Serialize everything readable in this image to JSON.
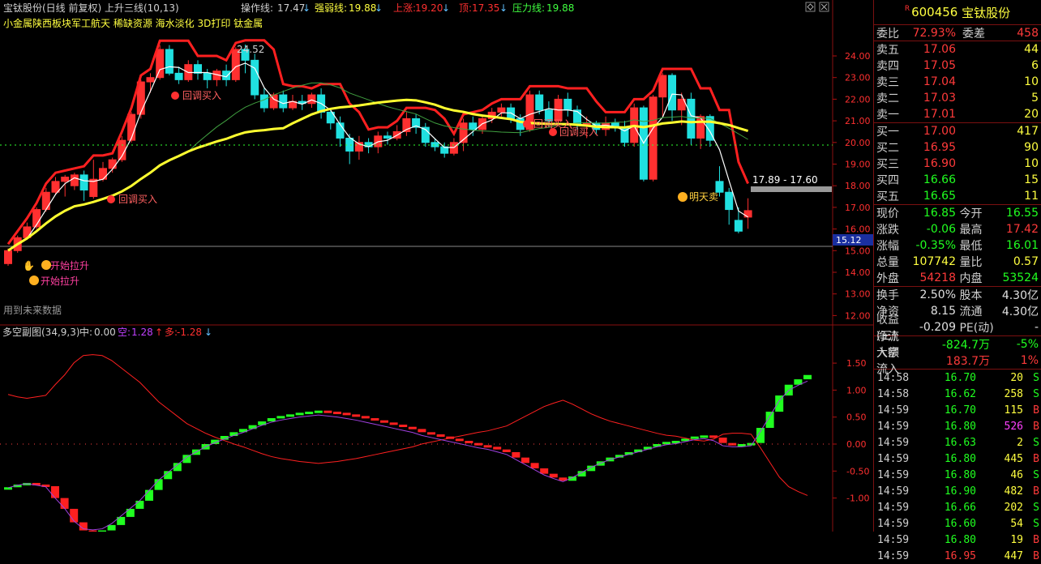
{
  "header": {
    "title": "宝钛股份(日线 前复权) 上升三线(10,13)",
    "op_label": "操作线:",
    "op_val": "17.47",
    "strong_label": "强弱线:",
    "strong_val": "19.88",
    "up_label": "上涨:",
    "up_val": "19.20",
    "top_label": "顶:",
    "top_val": "17.35",
    "press_label": "压力线:",
    "press_val": "19.88"
  },
  "concepts": "小金属陕西板块军工航天 稀缺资源 海水淡化 3D打印 钛金属",
  "annotations": {
    "peak": "24.52",
    "buy1": "回调买入",
    "buy2": "回调买入",
    "buy3": "回调买入",
    "buy4": "回调买入",
    "start1": "开始拉升",
    "start2": "开始拉升",
    "sell": "明天卖",
    "range": "17.89 - 17.60",
    "price_tag": "15.12",
    "future": "用到未来数据"
  },
  "y_axis_main": [
    "24.00",
    "23.00",
    "22.00",
    "21.00",
    "20.00",
    "19.00",
    "18.00",
    "17.00",
    "16.00",
    "15.00",
    "14.00",
    "13.00",
    "12.00"
  ],
  "sub": {
    "title": "多空副图(34,9,3)",
    "mid_label": "中:",
    "mid_val": "0.00",
    "empty_label": "空:",
    "empty_val": "1.28",
    "more_label": "多:",
    "more_val": "-1.28",
    "y_axis": [
      "1.50",
      "1.00",
      "0.50",
      "0.00",
      "-0.50",
      "-1.00"
    ]
  },
  "panel": {
    "code": "600456",
    "name": "宝钛股份",
    "weibi_label": "委比",
    "weibi": "72.93%",
    "weicha_label": "委差",
    "weicha": "458",
    "asks": [
      {
        "label": "卖五",
        "price": "17.06",
        "vol": "44"
      },
      {
        "label": "卖四",
        "price": "17.05",
        "vol": "6"
      },
      {
        "label": "卖三",
        "price": "17.04",
        "vol": "10"
      },
      {
        "label": "卖二",
        "price": "17.03",
        "vol": "5"
      },
      {
        "label": "卖一",
        "price": "17.01",
        "vol": "20"
      }
    ],
    "bids": [
      {
        "label": "买一",
        "price": "17.00",
        "vol": "417"
      },
      {
        "label": "买二",
        "price": "16.95",
        "vol": "90"
      },
      {
        "label": "买三",
        "price": "16.90",
        "vol": "10"
      },
      {
        "label": "买四",
        "price": "16.66",
        "vol": "15"
      },
      {
        "label": "买五",
        "price": "16.65",
        "vol": "11"
      }
    ],
    "stats": [
      {
        "l1": "现价",
        "v1": "16.85",
        "c1": "green",
        "l2": "今开",
        "v2": "16.55",
        "c2": "green"
      },
      {
        "l1": "涨跌",
        "v1": "-0.06",
        "c1": "green",
        "l2": "最高",
        "v2": "17.42",
        "c2": "red"
      },
      {
        "l1": "涨幅",
        "v1": "-0.35%",
        "c1": "green",
        "l2": "最低",
        "v2": "16.01",
        "c2": "green"
      },
      {
        "l1": "总量",
        "v1": "107742",
        "c1": "yellow",
        "l2": "量比",
        "v2": "0.57",
        "c2": "yellow"
      },
      {
        "l1": "外盘",
        "v1": "54218",
        "c1": "red",
        "l2": "内盘",
        "v2": "53524",
        "c2": "green"
      }
    ],
    "stats2": [
      {
        "l1": "换手",
        "v1": "2.50%",
        "c1": "white",
        "l2": "股本",
        "v2": "4.30亿",
        "c2": "white"
      },
      {
        "l1": "净资",
        "v1": "8.15",
        "c1": "white",
        "l2": "流通",
        "v2": "4.30亿",
        "c2": "white"
      },
      {
        "l1": "收益(三)",
        "v1": "-0.209",
        "c1": "white",
        "l2": "PE(动)",
        "v2": "-",
        "c2": "white"
      }
    ],
    "flow": [
      {
        "label": "净流入额",
        "val": "-824.7万",
        "pct": "-5%",
        "c": "green"
      },
      {
        "label": "大宗流入",
        "val": "183.7万",
        "pct": "1%",
        "c": "red"
      }
    ],
    "ticks": [
      {
        "t": "14:58",
        "p": "16.70",
        "v": "20",
        "bs": "S",
        "pc": "green",
        "vc": "yellow"
      },
      {
        "t": "14:58",
        "p": "16.62",
        "v": "258",
        "bs": "S",
        "pc": "green",
        "vc": "yellow"
      },
      {
        "t": "14:59",
        "p": "16.70",
        "v": "115",
        "bs": "B",
        "pc": "green",
        "vc": "yellow"
      },
      {
        "t": "14:59",
        "p": "16.80",
        "v": "526",
        "bs": "B",
        "pc": "green",
        "vc": "magenta"
      },
      {
        "t": "14:59",
        "p": "16.63",
        "v": "2",
        "bs": "S",
        "pc": "green",
        "vc": "yellow"
      },
      {
        "t": "14:59",
        "p": "16.80",
        "v": "445",
        "bs": "B",
        "pc": "green",
        "vc": "yellow"
      },
      {
        "t": "14:59",
        "p": "16.80",
        "v": "46",
        "bs": "S",
        "pc": "green",
        "vc": "yellow"
      },
      {
        "t": "14:59",
        "p": "16.90",
        "v": "482",
        "bs": "B",
        "pc": "green",
        "vc": "yellow"
      },
      {
        "t": "14:59",
        "p": "16.66",
        "v": "202",
        "bs": "S",
        "pc": "green",
        "vc": "yellow"
      },
      {
        "t": "14:59",
        "p": "16.60",
        "v": "54",
        "bs": "S",
        "pc": "green",
        "vc": "yellow"
      },
      {
        "t": "14:59",
        "p": "16.80",
        "v": "19",
        "bs": "B",
        "pc": "green",
        "vc": "yellow"
      },
      {
        "t": "14:59",
        "p": "16.95",
        "v": "447",
        "bs": "B",
        "pc": "red",
        "vc": "yellow"
      }
    ]
  },
  "colors": {
    "up": "#ff3030",
    "down": "#20e0e0",
    "ma_white": "#ffffff",
    "ma_yellow": "#ffff30",
    "ma_red": "#ff2020",
    "ma_blue": "#2040ff",
    "ma_green": "#40a040"
  },
  "chart_data": {
    "type": "candlestick",
    "y_axis_range": [
      12,
      24.6
    ],
    "candles": [
      [
        14.4,
        15.0,
        15.1,
        14.3
      ],
      [
        15.0,
        15.6,
        15.7,
        14.9
      ],
      [
        15.6,
        16.1,
        16.3,
        15.5
      ],
      [
        16.1,
        16.9,
        17.0,
        16.0
      ],
      [
        16.9,
        17.7,
        17.9,
        16.8
      ],
      [
        17.7,
        18.2,
        18.4,
        17.6
      ],
      [
        18.2,
        18.4,
        18.5,
        17.5
      ],
      [
        18.0,
        18.5,
        18.6,
        17.8
      ],
      [
        18.5,
        17.8,
        18.7,
        17.3
      ],
      [
        17.5,
        18.3,
        19.2,
        17.4
      ],
      [
        18.3,
        18.8,
        19.1,
        18.2
      ],
      [
        18.8,
        19.2,
        19.3,
        18.6
      ],
      [
        19.2,
        20.1,
        20.3,
        19.1
      ],
      [
        20.1,
        21.3,
        21.4,
        20.0
      ],
      [
        21.3,
        22.8,
        22.9,
        21.1
      ],
      [
        22.8,
        23.0,
        23.2,
        22.3
      ],
      [
        23.0,
        24.3,
        24.5,
        22.9
      ],
      [
        24.3,
        23.2,
        24.5,
        23.1
      ],
      [
        23.2,
        22.9,
        23.5,
        22.7
      ],
      [
        22.9,
        23.6,
        23.8,
        22.8
      ],
      [
        23.6,
        23.2,
        23.8,
        22.9
      ],
      [
        23.2,
        22.9,
        23.4,
        22.5
      ],
      [
        22.9,
        23.3,
        23.4,
        22.6
      ],
      [
        23.3,
        22.9,
        23.6,
        22.6
      ],
      [
        22.9,
        24.3,
        24.4,
        22.8
      ],
      [
        24.3,
        23.8,
        24.52,
        23.2
      ],
      [
        23.8,
        22.2,
        24.1,
        22.0
      ],
      [
        22.2,
        21.6,
        22.5,
        21.4
      ],
      [
        21.6,
        22.2,
        22.3,
        21.5
      ],
      [
        22.2,
        21.6,
        22.4,
        21.4
      ],
      [
        21.6,
        21.9,
        22.2,
        21.5
      ],
      [
        21.9,
        21.8,
        22.2,
        21.5
      ],
      [
        21.8,
        22.2,
        22.3,
        21.6
      ],
      [
        22.2,
        21.4,
        22.5,
        21.1
      ],
      [
        21.4,
        20.9,
        21.6,
        20.6
      ],
      [
        20.9,
        20.2,
        21.2,
        19.8
      ],
      [
        20.2,
        19.6,
        20.4,
        19.0
      ],
      [
        19.6,
        20.0,
        20.3,
        19.2
      ],
      [
        20.0,
        19.8,
        20.2,
        19.5
      ],
      [
        19.8,
        20.3,
        20.5,
        19.5
      ],
      [
        20.3,
        20.2,
        20.5,
        19.9
      ],
      [
        20.2,
        20.5,
        20.8,
        20.1
      ],
      [
        20.5,
        21.1,
        21.4,
        20.3
      ],
      [
        21.1,
        20.7,
        21.3,
        20.4
      ],
      [
        20.7,
        20.0,
        20.9,
        19.8
      ],
      [
        20.0,
        19.8,
        20.2,
        19.6
      ],
      [
        19.8,
        19.5,
        20.0,
        19.3
      ],
      [
        19.5,
        20.0,
        20.2,
        19.4
      ],
      [
        20.0,
        20.9,
        21.1,
        19.6
      ],
      [
        20.9,
        20.6,
        21.2,
        20.3
      ],
      [
        20.6,
        21.1,
        21.3,
        20.4
      ],
      [
        21.1,
        21.4,
        21.6,
        20.9
      ],
      [
        21.4,
        21.6,
        21.8,
        21.2
      ],
      [
        21.6,
        21.1,
        21.8,
        20.9
      ],
      [
        21.1,
        20.6,
        21.3,
        20.3
      ],
      [
        20.6,
        22.2,
        22.4,
        20.5
      ],
      [
        22.2,
        21.5,
        22.4,
        21.3
      ],
      [
        21.5,
        21.0,
        21.9,
        20.7
      ],
      [
        21.0,
        22.0,
        22.2,
        20.9
      ],
      [
        22.0,
        21.5,
        22.3,
        21.2
      ],
      [
        21.5,
        20.8,
        21.7,
        20.6
      ],
      [
        20.8,
        20.9,
        21.2,
        20.2
      ],
      [
        20.9,
        20.6,
        21.0,
        20.4
      ],
      [
        20.6,
        20.9,
        21.2,
        20.3
      ],
      [
        20.9,
        20.7,
        21.1,
        20.5
      ],
      [
        20.7,
        20.0,
        21.0,
        19.8
      ],
      [
        20.0,
        21.6,
        21.8,
        19.8
      ],
      [
        21.6,
        18.3,
        21.7,
        18.2
      ],
      [
        18.3,
        22.1,
        22.2,
        18.2
      ],
      [
        22.1,
        23.1,
        23.2,
        21.2
      ],
      [
        23.1,
        21.5,
        23.2,
        21.0
      ],
      [
        21.5,
        22.0,
        22.3,
        20.8
      ],
      [
        22.0,
        20.2,
        22.3,
        19.9
      ],
      [
        20.2,
        21.2,
        21.3,
        19.7
      ],
      [
        21.2,
        20.1,
        21.3,
        19.8
      ],
      [
        18.2,
        17.7,
        18.9,
        17.5
      ],
      [
        17.7,
        16.9,
        17.9,
        16.2
      ],
      [
        16.4,
        15.9,
        17.0,
        15.8
      ],
      [
        16.55,
        16.85,
        17.42,
        16.01
      ]
    ],
    "sub_series": {
      "type": "bar",
      "values": [
        -0.8,
        -0.75,
        -0.72,
        -0.75,
        -0.78,
        -1.0,
        -1.2,
        -1.45,
        -1.6,
        -1.62,
        -1.6,
        -1.5,
        -1.35,
        -1.2,
        -1.05,
        -0.85,
        -0.65,
        -0.5,
        -0.35,
        -0.2,
        -0.1,
        0.0,
        0.08,
        0.15,
        0.22,
        0.28,
        0.35,
        0.42,
        0.48,
        0.52,
        0.55,
        0.58,
        0.6,
        0.62,
        0.6,
        0.58,
        0.55,
        0.52,
        0.48,
        0.44,
        0.4,
        0.36,
        0.32,
        0.28,
        0.22,
        0.18,
        0.14,
        0.1,
        0.06,
        0.02,
        -0.02,
        -0.05,
        -0.1,
        -0.15,
        -0.25,
        -0.35,
        -0.45,
        -0.55,
        -0.62,
        -0.68,
        -0.6,
        -0.5,
        -0.4,
        -0.32,
        -0.25,
        -0.2,
        -0.15,
        -0.1,
        -0.05,
        0.0,
        0.04,
        0.06,
        0.1,
        0.14,
        0.16,
        0.12,
        0.02,
        0.0,
        0.0,
        0.02,
        0.3,
        0.6,
        0.9,
        1.1,
        1.2,
        1.28
      ]
    }
  }
}
